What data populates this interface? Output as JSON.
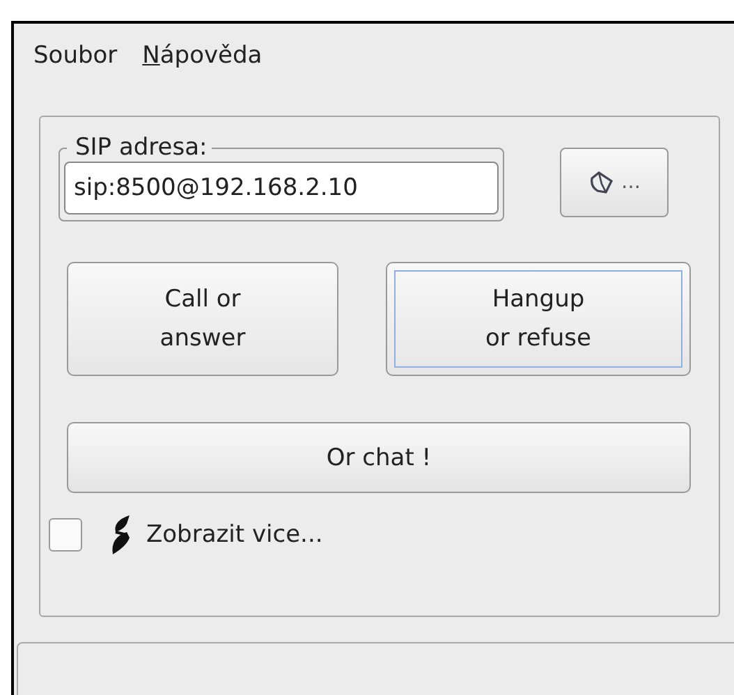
{
  "menu": [
    {
      "label": "Soubor",
      "underlined_first": false
    },
    {
      "label": "Nápověda",
      "underlined_first": true
    }
  ],
  "sip_group": {
    "legend": "SIP adresa:",
    "value": "sip:8500@192.168.2.10"
  },
  "browse_button": {
    "label": "…"
  },
  "buttons": [
    {
      "label": "Call or\nanswer",
      "focused": false
    },
    {
      "label": "Hangup\nor refuse",
      "focused": true
    }
  ],
  "chat_button": {
    "label": "Or chat !"
  },
  "more": {
    "label": "Zobrazit vice...",
    "checked": false
  }
}
